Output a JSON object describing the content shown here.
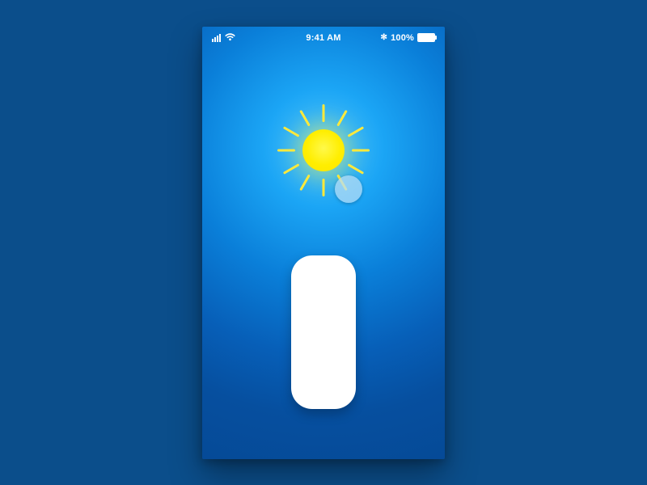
{
  "status_bar": {
    "time": "9:41 AM",
    "battery_text": "100%",
    "battery_level": 1.0,
    "bluetooth_glyph": "✻"
  },
  "icons": {
    "sun": "sun-icon",
    "touch_indicator": "touch-indicator",
    "signal": "cellular-signal-icon",
    "wifi": "wifi-icon",
    "bluetooth": "bluetooth-icon",
    "battery": "battery-icon"
  },
  "slider": {
    "value": 1.0
  },
  "colors": {
    "accent_sun": "#ffee00",
    "bg_outer": "#0b4e8b",
    "bg_glow": "#1ba5f5"
  }
}
